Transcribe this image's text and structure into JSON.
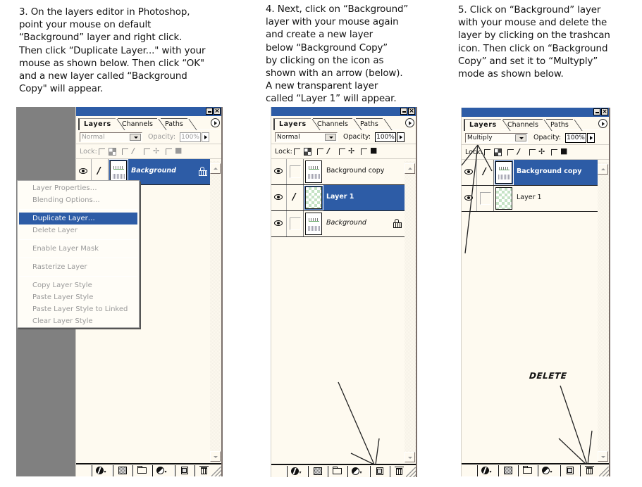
{
  "instructions": {
    "step3": [
      "3. On the layers editor in Photoshop,",
      "point your mouse on default",
      "“Background” layer and right click.",
      "Then click “Duplicate Layer...\" with your",
      "mouse as shown below. Then click “OK\"",
      "and a new layer called “Background",
      "Copy\" will appear."
    ],
    "step4": [
      "4. Next, click on “Background”",
      "layer with your mouse again",
      "and create a new layer",
      "below “Background Copy”",
      "by clicking on the icon as",
      "shown with an arrow (below).",
      "A new transparent layer",
      "called “Layer 1” will appear."
    ],
    "step5": [
      "5. Click on “Background” layer",
      "with your mouse and delete the",
      "layer by clicking on the trashcan",
      "icon. Then click on “Background",
      "Copy” and set it to “Multyply”",
      "mode as shown below."
    ]
  },
  "panel_common": {
    "tabs": [
      "Layers",
      "Channels",
      "Paths"
    ],
    "opacity_label": "Opacity:",
    "lock_label": "Lock:",
    "minimize_icon": "minimize-icon",
    "close_glyph": "×",
    "footer_icons": [
      "layer-style-icon",
      "layer-mask-icon",
      "layer-set-folder-icon",
      "adjustment-layer-icon",
      "new-layer-icon",
      "trash-icon"
    ]
  },
  "panel1": {
    "blend_mode": "Normal",
    "opacity": "100%",
    "layers": [
      {
        "name": "Background",
        "selected": true,
        "locked": true,
        "italic": true,
        "linked_brush": true,
        "thumb": "image"
      }
    ]
  },
  "context_menu": {
    "groups": [
      [
        "Layer Properties…",
        "Blending Options…"
      ],
      [
        "Duplicate Layer…",
        "Delete Layer"
      ],
      [
        "Enable Layer Mask"
      ],
      [
        "Rasterize Layer"
      ],
      [
        "Copy Layer Style",
        "Paste Layer Style",
        "Paste Layer Style to Linked",
        "Clear Layer Style"
      ]
    ],
    "highlighted": "Duplicate Layer…"
  },
  "panel2": {
    "blend_mode": "Normal",
    "opacity": "100%",
    "layers": [
      {
        "name": "Background copy",
        "selected": false,
        "locked": false,
        "italic": false,
        "linked_brush": false,
        "thumb": "image"
      },
      {
        "name": "Layer 1",
        "selected": true,
        "locked": false,
        "italic": false,
        "linked_brush": true,
        "thumb": "transparent"
      },
      {
        "name": "Background",
        "selected": false,
        "locked": true,
        "italic": true,
        "linked_brush": false,
        "thumb": "image"
      }
    ]
  },
  "panel3": {
    "blend_mode": "Multiply",
    "opacity": "100%",
    "layers": [
      {
        "name": "Background copy",
        "selected": true,
        "locked": false,
        "italic": false,
        "linked_brush": true,
        "thumb": "image"
      },
      {
        "name": "Layer 1",
        "selected": false,
        "locked": false,
        "italic": false,
        "linked_brush": false,
        "thumb": "transparent"
      }
    ],
    "annotation": "DELETE"
  },
  "colors": {
    "selection_blue": "#2d5ca6",
    "panel_bg": "#fefaf0",
    "canvas_gray": "#808080"
  }
}
